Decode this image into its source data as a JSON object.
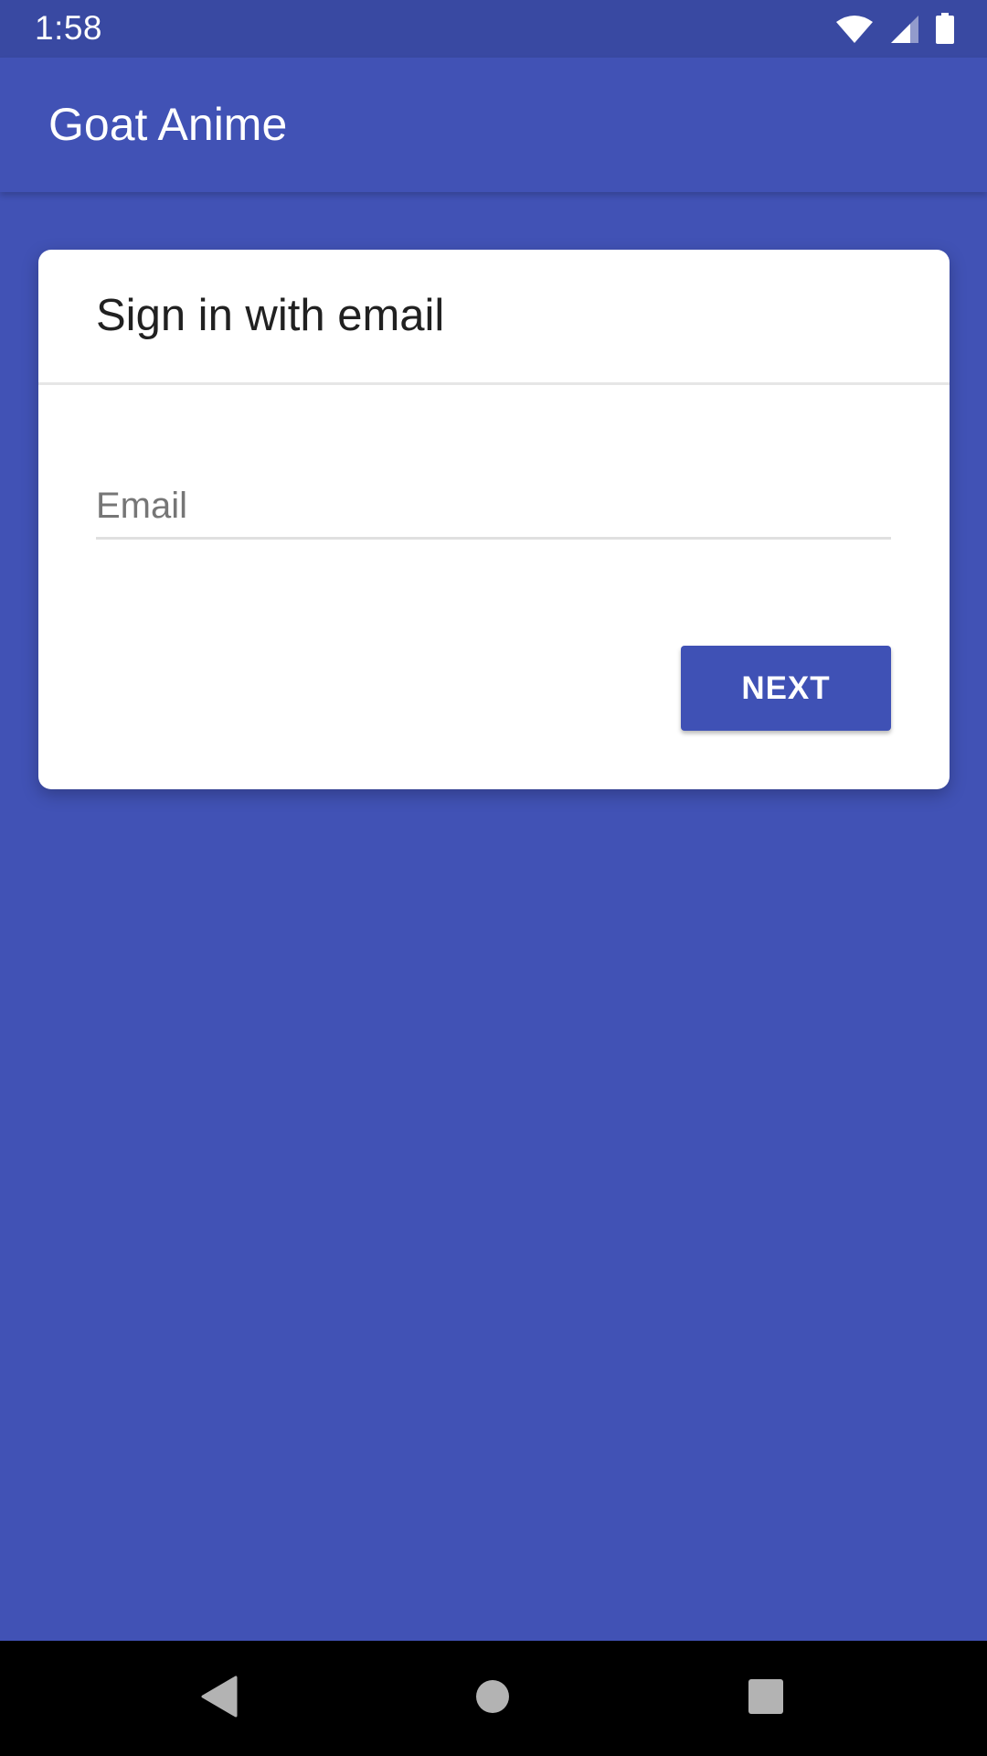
{
  "status_bar": {
    "time": "1:58",
    "icons": [
      "wifi-icon",
      "cell-signal-icon",
      "battery-icon"
    ]
  },
  "app_bar": {
    "title": "Goat Anime"
  },
  "sign_in_card": {
    "title": "Sign in with email",
    "email_field": {
      "value": "",
      "placeholder": "Email"
    },
    "next_label": "NEXT"
  },
  "nav_bar": {
    "icons": [
      "back-icon",
      "home-icon",
      "recents-icon"
    ]
  },
  "colors": {
    "primary": "#3f51b5",
    "primary_dark": "#3949a2",
    "background": "#4152b5",
    "card": "#ffffff",
    "title_text": "#212121",
    "hint_text": "#767676"
  }
}
